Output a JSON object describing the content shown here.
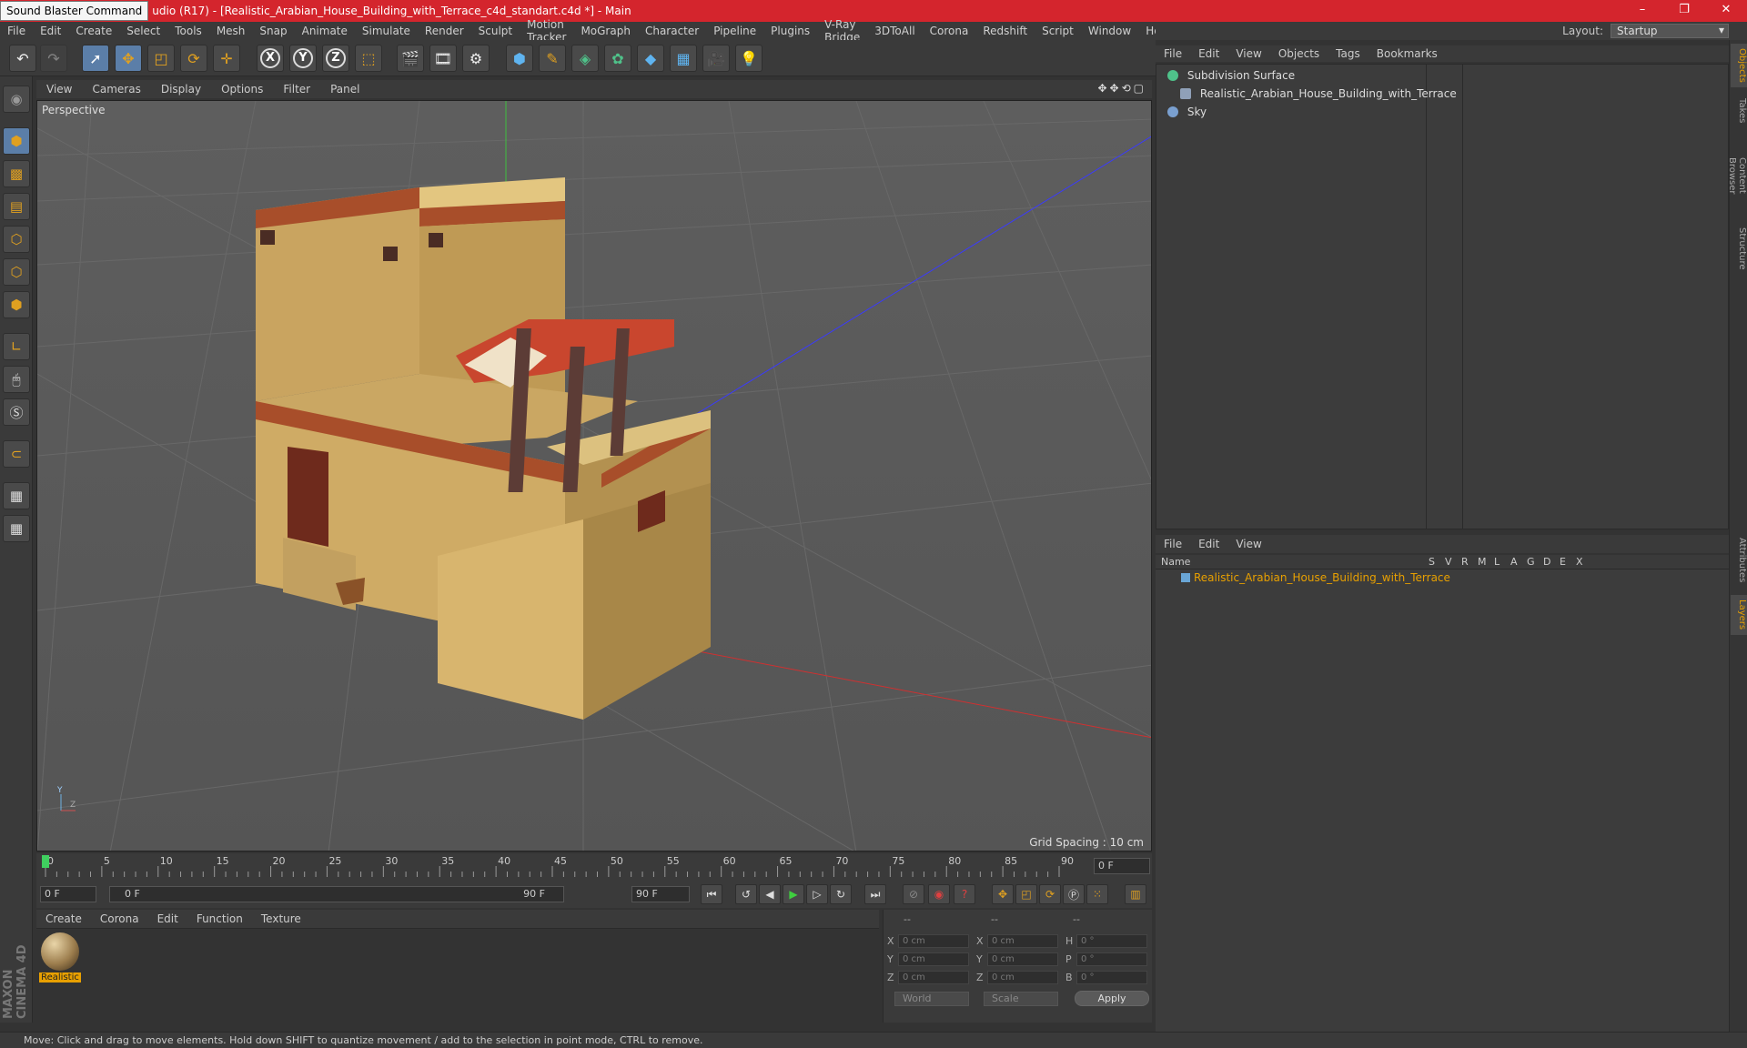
{
  "window": {
    "tooltip": "Sound Blaster Command",
    "title": "udio (R17) - [Realistic_Arabian_House_Building_with_Terrace_c4d_standart.c4d *] - Main",
    "controls": [
      "–",
      "❐",
      "✕"
    ]
  },
  "menubar": [
    "File",
    "Edit",
    "Create",
    "Select",
    "Tools",
    "Mesh",
    "Snap",
    "Animate",
    "Simulate",
    "Render",
    "Sculpt",
    "Motion Tracker",
    "MoGraph",
    "Character",
    "Pipeline",
    "Plugins",
    "V-Ray Bridge",
    "3DToAll",
    "Corona",
    "Redshift",
    "Script",
    "Window",
    "Help"
  ],
  "layout": {
    "label": "Layout:",
    "value": "Startup"
  },
  "viewport": {
    "menu": [
      "View",
      "Cameras",
      "Display",
      "Options",
      "Filter",
      "Panel"
    ],
    "nav_icons": "✥✥⟲▢",
    "label": "Perspective",
    "grid_spacing": "Grid Spacing : 10 cm"
  },
  "timeline": {
    "ticks": [
      "0",
      "5",
      "10",
      "15",
      "20",
      "25",
      "30",
      "35",
      "40",
      "45",
      "50",
      "55",
      "60",
      "65",
      "70",
      "75",
      "80",
      "85",
      "90"
    ],
    "current_frame": "0 F"
  },
  "transport": {
    "start": "0 F",
    "range_start": "0 F",
    "range_end": "90 F",
    "end": "90 F"
  },
  "material_manager": {
    "menu": [
      "Create",
      "Corona",
      "Edit",
      "Function",
      "Texture"
    ],
    "materials": [
      {
        "name": "Realistic"
      }
    ],
    "brand": "MAXON CINEMA 4D"
  },
  "coordinates": {
    "header": [
      "--",
      "--",
      "--"
    ],
    "rows": [
      {
        "a": "X",
        "av": "0 cm",
        "b": "X",
        "bv": "0 cm",
        "c": "H",
        "cv": "0 °"
      },
      {
        "a": "Y",
        "av": "0 cm",
        "b": "Y",
        "bv": "0 cm",
        "c": "P",
        "cv": "0 °"
      },
      {
        "a": "Z",
        "av": "0 cm",
        "b": "Z",
        "bv": "0 cm",
        "c": "B",
        "cv": "0 °"
      }
    ],
    "mode": "World",
    "size_mode": "Scale",
    "apply": "Apply"
  },
  "object_manager": {
    "menu": [
      "File",
      "Edit",
      "View",
      "Objects",
      "Tags",
      "Bookmarks"
    ],
    "objects": [
      {
        "name": "Subdivision Surface",
        "color": "#4fc28a"
      },
      {
        "name": "Realistic_Arabian_House_Building_with_Terrace",
        "color": "#8fa0b8"
      },
      {
        "name": "Sky",
        "color": "#7aa0d0"
      }
    ]
  },
  "layer_manager": {
    "menu": [
      "File",
      "Edit",
      "View"
    ],
    "columns": [
      "Name",
      "S",
      "V",
      "R",
      "M",
      "L",
      "A",
      "G",
      "D",
      "E",
      "X"
    ],
    "layers": [
      {
        "name": "Realistic_Arabian_House_Building_with_Terrace"
      }
    ]
  },
  "side_tabs": [
    "Objects",
    "Takes",
    "Content Browser",
    "Structure",
    "Attributes",
    "Layers"
  ],
  "status": "Move: Click and drag to move elements. Hold down SHIFT to quantize movement / add to the selection in point mode, CTRL to remove.",
  "colors": {
    "titlebar": "#d4252d",
    "accent": "#e8a000",
    "active": "#5b7ea8"
  }
}
